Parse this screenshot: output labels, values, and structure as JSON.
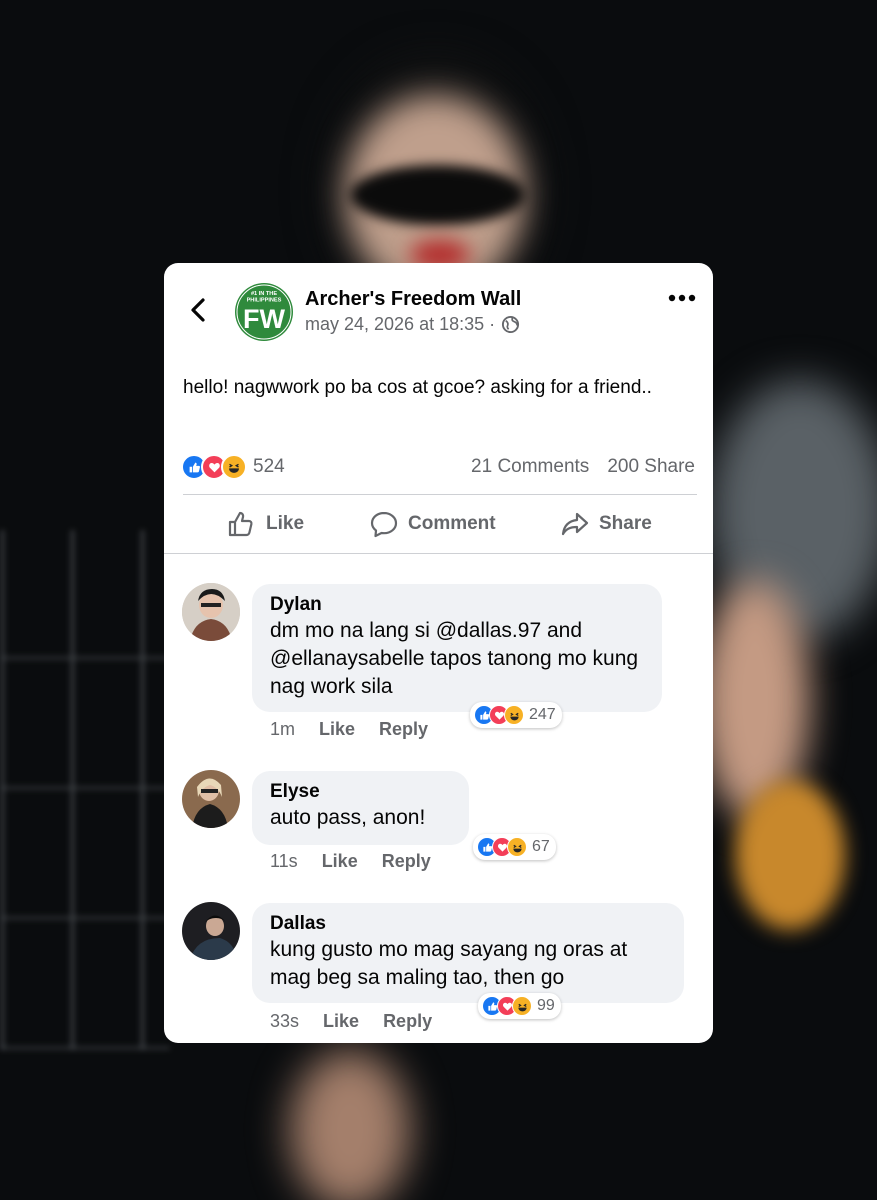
{
  "post": {
    "page_name": "Archer's Freedom Wall",
    "logo_text": "FW",
    "logo_ring_text": "#1 IN THE PHILIPPINES",
    "timestamp": "may 24, 2026 at 18:35 ·",
    "body": "hello! nagwwork po ba cos at gcoe? asking for a friend..",
    "reaction_count": "524",
    "comments_count": "21 Comments",
    "share_count": "200 Share",
    "reactions": [
      "like",
      "love",
      "haha"
    ]
  },
  "actions": {
    "like": "Like",
    "comment": "Comment",
    "share": "Share"
  },
  "comments": [
    {
      "name": "Dylan",
      "text": "dm mo na lang si @dallas.97 and @ellanaysabelle tapos tanong mo kung nag work sila",
      "time": "1m",
      "like": "Like",
      "reply": "Reply",
      "reaction_count": "247"
    },
    {
      "name": "Elyse",
      "text": "auto pass, anon!",
      "time": "11s",
      "like": "Like",
      "reply": "Reply",
      "reaction_count": "67"
    },
    {
      "name": "Dallas",
      "text": "kung gusto mo mag sayang ng oras at mag beg sa maling tao, then go",
      "time": "33s",
      "like": "Like",
      "reply": "Reply",
      "reaction_count": "99"
    }
  ],
  "colors": {
    "like_blue": "#1877f2",
    "love_red": "#f33e58",
    "haha_yellow": "#f7b125",
    "logo_green": "#2f8a3c"
  }
}
